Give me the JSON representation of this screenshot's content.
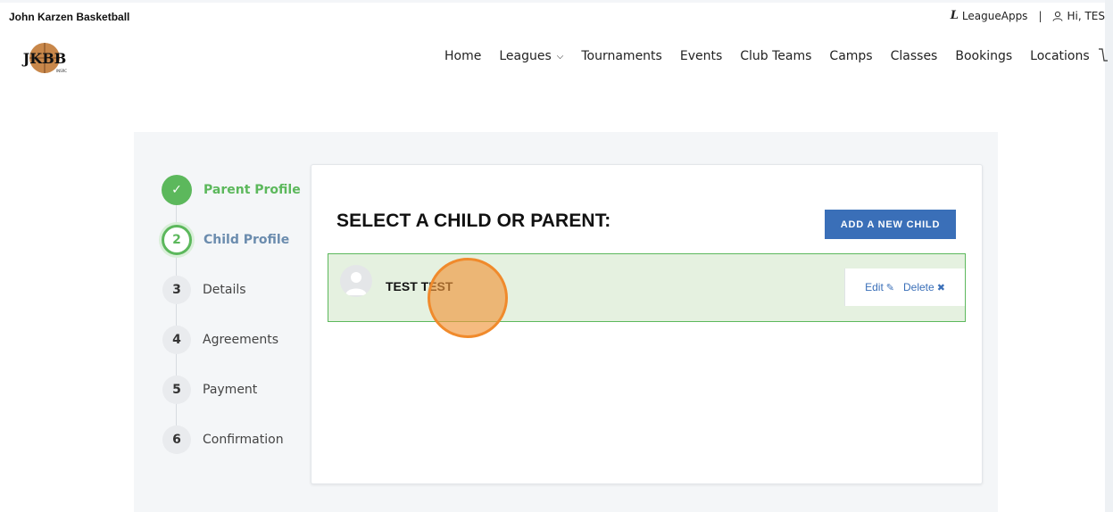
{
  "header": {
    "org_name": "John Karzen Basketball",
    "leagueapps_label": "LeagueApps",
    "separator": "|",
    "user_greeting": "Hi, TES"
  },
  "logo": {
    "text": "JKBB",
    "subtext": "INSRC"
  },
  "nav": {
    "items": [
      "Home",
      "Leagues",
      "Tournaments",
      "Events",
      "Club Teams",
      "Camps",
      "Classes",
      "Bookings",
      "Locations"
    ],
    "leagues_chevron": "⌵"
  },
  "steps": [
    {
      "number": "✓",
      "label": "Parent Profile",
      "state": "done"
    },
    {
      "number": "2",
      "label": "Child Profile",
      "state": "active"
    },
    {
      "number": "3",
      "label": "Details",
      "state": "pending"
    },
    {
      "number": "4",
      "label": "Agreements",
      "state": "pending"
    },
    {
      "number": "5",
      "label": "Payment",
      "state": "pending"
    },
    {
      "number": "6",
      "label": "Confirmation",
      "state": "pending"
    }
  ],
  "card": {
    "title": "SELECT A CHILD OR PARENT:",
    "add_button": "ADD A NEW CHILD"
  },
  "child": {
    "name": "TEST TEST",
    "edit_label": "Edit",
    "edit_icon": "✎",
    "delete_label": "Delete",
    "delete_icon": "✖"
  },
  "colors": {
    "success": "#5cb85c",
    "primary": "#3a6fb8",
    "selected_row": "#e5f1e0",
    "click_indicator": "#f08a2c"
  }
}
